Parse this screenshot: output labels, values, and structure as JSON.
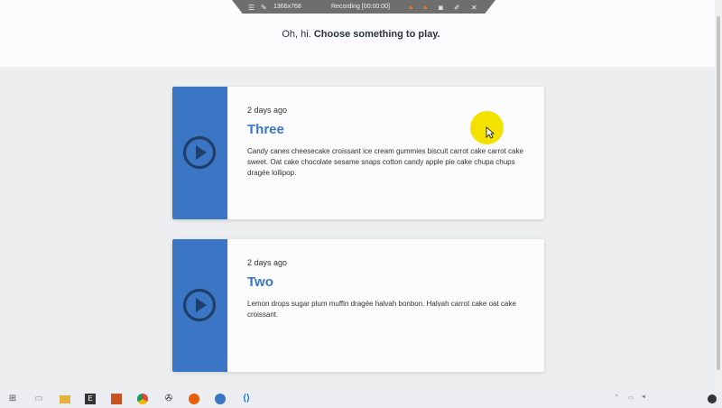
{
  "header": {
    "greeting_prefix": "Oh, hi.",
    "greeting_bold": "Choose something to play."
  },
  "recording_bar": {
    "resolution": "1366x768",
    "status": "Recording [00:00:00]"
  },
  "cards": [
    {
      "date": "2 days ago",
      "title": "Three",
      "description": "Candy canes cheesecake croissant ice cream gummies biscuit carrot cake carrot cake sweet. Oat cake chocolate sesame snaps cotton candy apple pie cake chupa chups dragée lollipop."
    },
    {
      "date": "2 days ago",
      "title": "Two",
      "description": "Lemon drops sugar plum muffin dragée halvah bonbon. Halvah carrot cake oat cake croissant."
    }
  ],
  "colors": {
    "accent": "#3a76c4",
    "card_bg": "#fbfbfd",
    "page_bg": "#eceeef",
    "cursor_highlight": "#f3e100"
  },
  "taskbar": {
    "apps": [
      "windows-start-icon",
      "task-view-icon",
      "file-explorer-icon",
      "terminal-icon",
      "app-icon",
      "chrome-icon",
      "github-icon",
      "firefox-icon",
      "app-icon",
      "vscode-icon"
    ]
  }
}
